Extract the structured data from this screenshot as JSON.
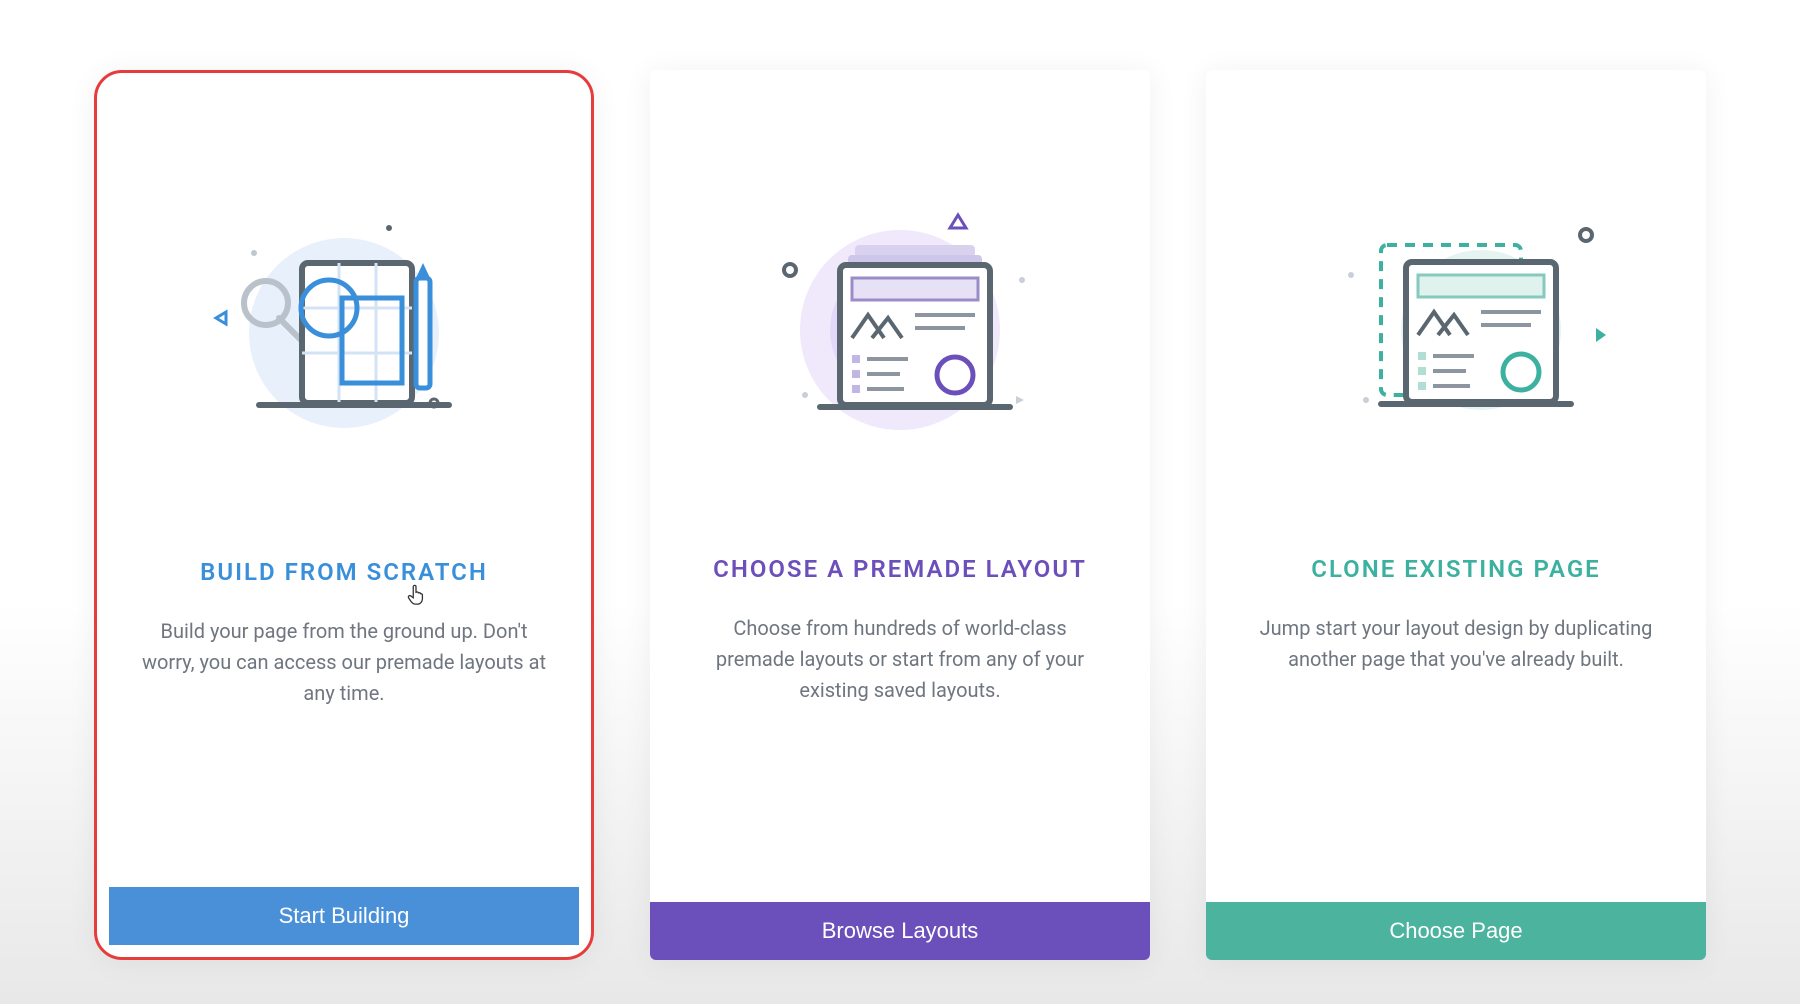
{
  "cards": [
    {
      "title": "BUILD FROM SCRATCH",
      "description": "Build your page from the ground up. Don't worry, you can access our premade layouts at any time.",
      "button": "Start Building",
      "accent": "blue",
      "highlighted": true
    },
    {
      "title": "CHOOSE A PREMADE LAYOUT",
      "description": "Choose from hundreds of world-class premade layouts or start from any of your existing saved layouts.",
      "button": "Browse Layouts",
      "accent": "purple",
      "highlighted": false
    },
    {
      "title": "CLONE EXISTING PAGE",
      "description": "Jump start your layout design by duplicating another page that you've already built.",
      "button": "Choose Page",
      "accent": "teal",
      "highlighted": false
    }
  ]
}
